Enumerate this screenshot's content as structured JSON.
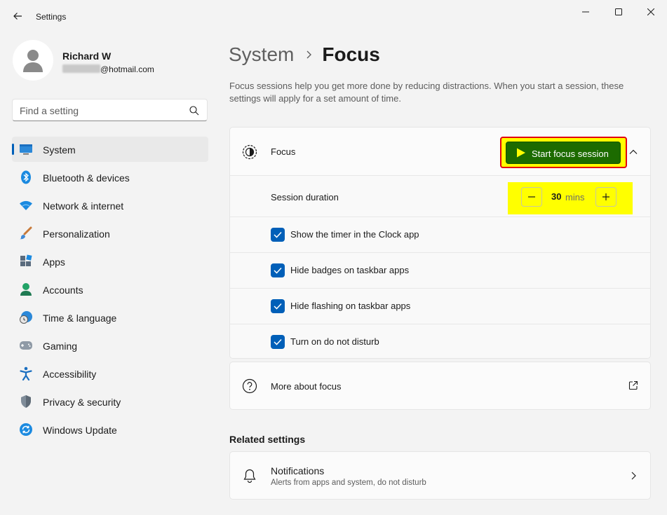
{
  "window": {
    "title": "Settings",
    "colors": {
      "accent": "#005fb8",
      "highlight_red": "#e3000f",
      "highlight_yellow": "#ffff00",
      "start_button": "#1c6b00"
    }
  },
  "profile": {
    "name": "Richard W",
    "email_visible": "@hotmail.com"
  },
  "search": {
    "placeholder": "Find a setting"
  },
  "sidebar": {
    "items": [
      {
        "label": "System",
        "icon": "monitor-icon",
        "active": true
      },
      {
        "label": "Bluetooth & devices",
        "icon": "bluetooth-icon"
      },
      {
        "label": "Network & internet",
        "icon": "wifi-icon"
      },
      {
        "label": "Personalization",
        "icon": "paintbrush-icon"
      },
      {
        "label": "Apps",
        "icon": "apps-icon"
      },
      {
        "label": "Accounts",
        "icon": "person-icon"
      },
      {
        "label": "Time & language",
        "icon": "globe-clock-icon"
      },
      {
        "label": "Gaming",
        "icon": "gamepad-icon"
      },
      {
        "label": "Accessibility",
        "icon": "accessibility-icon"
      },
      {
        "label": "Privacy & security",
        "icon": "shield-icon"
      },
      {
        "label": "Windows Update",
        "icon": "update-icon"
      }
    ]
  },
  "breadcrumb": {
    "parent": "System",
    "current": "Focus"
  },
  "main": {
    "description": "Focus sessions help you get more done by reducing distractions. When you start a session, these settings will apply for a set amount of time.",
    "focus": {
      "label": "Focus",
      "start_button": "Start focus session",
      "expanded": true
    },
    "session_duration": {
      "label": "Session duration",
      "value": "30",
      "unit": "mins"
    },
    "options": [
      {
        "label": "Show the timer in the Clock app",
        "checked": true
      },
      {
        "label": "Hide badges on taskbar apps",
        "checked": true
      },
      {
        "label": "Hide flashing on taskbar apps",
        "checked": true
      },
      {
        "label": "Turn on do not disturb",
        "checked": true
      }
    ],
    "more_about": {
      "label": "More about focus"
    },
    "related": {
      "heading": "Related settings",
      "notifications": {
        "title": "Notifications",
        "subtitle": "Alerts from apps and system, do not disturb"
      }
    }
  }
}
